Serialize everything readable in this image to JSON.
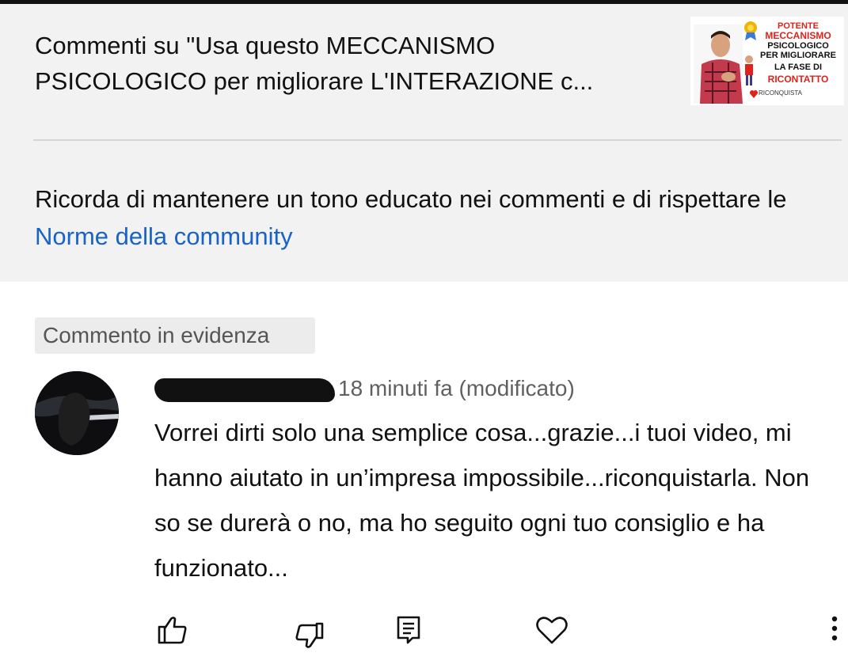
{
  "header": {
    "title": "Commenti su \"Usa questo MECCANISMO PSICOLOGICO per migliorare L'INTERAZIONE c...",
    "thumbnail": {
      "line1": "POTENTE",
      "line2": "MECCANISMO",
      "line3": "PSICOLOGICO",
      "line4": "PER MIGLIORARE",
      "line5": "LA FASE DI",
      "line6": "RICONTATTO",
      "brand": "RICONQUISTA"
    }
  },
  "notice": {
    "text": "Ricorda di mantenere un tono educato nei commenti e di rispettare le ",
    "link": "Norme della community"
  },
  "pinned_label": "Commento in evidenza",
  "comment": {
    "time": "18 minuti fa (modificato)",
    "text": "Vorrei dirti solo una semplice cosa...grazie...i tuoi video, mi hanno aiutato in un’impresa impossibile...riconquistarla. Non so se durerà o no, ma ho seguito ogni tuo consiglio e ha funzionato..."
  },
  "actions": [
    {
      "icon": "thumbs-up-icon"
    },
    {
      "icon": "thumbs-down-icon"
    },
    {
      "icon": "reply-icon"
    },
    {
      "icon": "heart-icon"
    },
    {
      "icon": "more-vert-icon"
    }
  ],
  "colors": {
    "header_bg": "#f2f2f2",
    "link": "#1a63c6",
    "thumbnail_red": "#e0221b"
  }
}
